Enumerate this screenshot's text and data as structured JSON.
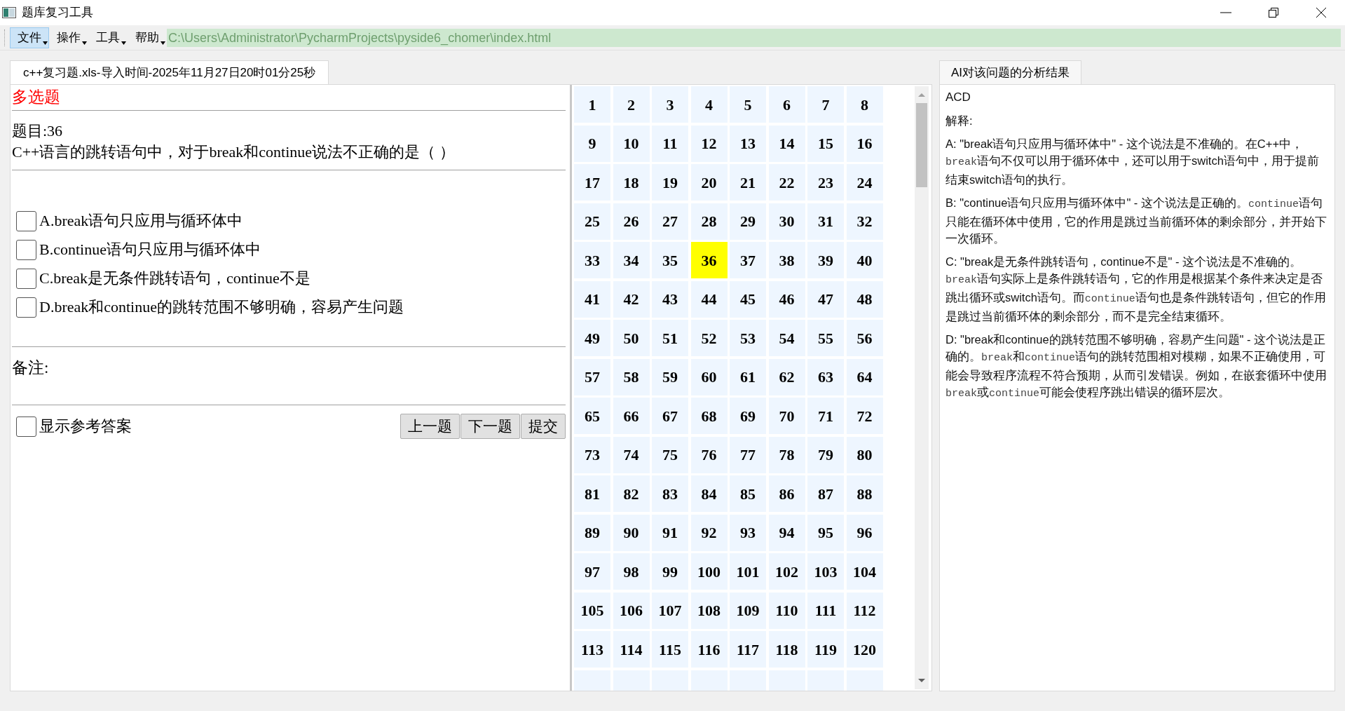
{
  "window": {
    "title": "题库复习工具"
  },
  "menu": [
    {
      "label": "文件",
      "selected": true
    },
    {
      "label": "操作",
      "selected": false
    },
    {
      "label": "工具",
      "selected": false
    },
    {
      "label": "帮助",
      "selected": false
    }
  ],
  "path_field": {
    "value": "C:\\Users\\Administrator\\PycharmProjects\\pyside6_chomer\\index.html"
  },
  "left_tab": {
    "label": "c++复习题.xls-导入时间-2025年11月27日20时01分25秒",
    "selected": true
  },
  "question": {
    "type_label": "多选题",
    "number": "题目:36",
    "text": "C++语言的跳转语句中，对于break和continue说法不正确的是（ ）",
    "options": [
      {
        "label": "A.break语句只应用与循环体中",
        "checked": false
      },
      {
        "label": "B.continue语句只应用与循环体中",
        "checked": false
      },
      {
        "label": "C.break是无条件跳转语句，continue不是",
        "checked": false
      },
      {
        "label": "D.break和continue的跳转范围不够明确，容易产生问题",
        "checked": false
      }
    ],
    "notes_label": "备注:",
    "show_answer": {
      "label": "显示参考答案",
      "checked": false
    }
  },
  "buttons": [
    "上一题",
    "下一题",
    "提交"
  ],
  "grid": {
    "cells": [
      {
        "label": "1",
        "selected": false
      },
      {
        "label": "2",
        "selected": false
      },
      {
        "label": "3",
        "selected": false
      },
      {
        "label": "4",
        "selected": false
      },
      {
        "label": "5",
        "selected": false
      },
      {
        "label": "6",
        "selected": false
      },
      {
        "label": "7",
        "selected": false
      },
      {
        "label": "8",
        "selected": false
      },
      {
        "label": "9",
        "selected": false
      },
      {
        "label": "10",
        "selected": false
      },
      {
        "label": "11",
        "selected": false
      },
      {
        "label": "12",
        "selected": false
      },
      {
        "label": "13",
        "selected": false
      },
      {
        "label": "14",
        "selected": false
      },
      {
        "label": "15",
        "selected": false
      },
      {
        "label": "16",
        "selected": false
      },
      {
        "label": "17",
        "selected": false
      },
      {
        "label": "18",
        "selected": false
      },
      {
        "label": "19",
        "selected": false
      },
      {
        "label": "20",
        "selected": false
      },
      {
        "label": "21",
        "selected": false
      },
      {
        "label": "22",
        "selected": false
      },
      {
        "label": "23",
        "selected": false
      },
      {
        "label": "24",
        "selected": false
      },
      {
        "label": "25",
        "selected": false
      },
      {
        "label": "26",
        "selected": false
      },
      {
        "label": "27",
        "selected": false
      },
      {
        "label": "28",
        "selected": false
      },
      {
        "label": "29",
        "selected": false
      },
      {
        "label": "30",
        "selected": false
      },
      {
        "label": "31",
        "selected": false
      },
      {
        "label": "32",
        "selected": false
      },
      {
        "label": "33",
        "selected": false
      },
      {
        "label": "34",
        "selected": false
      },
      {
        "label": "35",
        "selected": false
      },
      {
        "label": "36",
        "selected": true
      },
      {
        "label": "37",
        "selected": false
      },
      {
        "label": "38",
        "selected": false
      },
      {
        "label": "39",
        "selected": false
      },
      {
        "label": "40",
        "selected": false
      },
      {
        "label": "41",
        "selected": false
      },
      {
        "label": "42",
        "selected": false
      },
      {
        "label": "43",
        "selected": false
      },
      {
        "label": "44",
        "selected": false
      },
      {
        "label": "45",
        "selected": false
      },
      {
        "label": "46",
        "selected": false
      },
      {
        "label": "47",
        "selected": false
      },
      {
        "label": "48",
        "selected": false
      },
      {
        "label": "49",
        "selected": false
      },
      {
        "label": "50",
        "selected": false
      },
      {
        "label": "51",
        "selected": false
      },
      {
        "label": "52",
        "selected": false
      },
      {
        "label": "53",
        "selected": false
      },
      {
        "label": "54",
        "selected": false
      },
      {
        "label": "55",
        "selected": false
      },
      {
        "label": "56",
        "selected": false
      },
      {
        "label": "57",
        "selected": false
      },
      {
        "label": "58",
        "selected": false
      },
      {
        "label": "59",
        "selected": false
      },
      {
        "label": "60",
        "selected": false
      },
      {
        "label": "61",
        "selected": false
      },
      {
        "label": "62",
        "selected": false
      },
      {
        "label": "63",
        "selected": false
      },
      {
        "label": "64",
        "selected": false
      },
      {
        "label": "65",
        "selected": false
      },
      {
        "label": "66",
        "selected": false
      },
      {
        "label": "67",
        "selected": false
      },
      {
        "label": "68",
        "selected": false
      },
      {
        "label": "69",
        "selected": false
      },
      {
        "label": "70",
        "selected": false
      },
      {
        "label": "71",
        "selected": false
      },
      {
        "label": "72",
        "selected": false
      },
      {
        "label": "73",
        "selected": false
      },
      {
        "label": "74",
        "selected": false
      },
      {
        "label": "75",
        "selected": false
      },
      {
        "label": "76",
        "selected": false
      },
      {
        "label": "77",
        "selected": false
      },
      {
        "label": "78",
        "selected": false
      },
      {
        "label": "79",
        "selected": false
      },
      {
        "label": "80",
        "selected": false
      },
      {
        "label": "81",
        "selected": false
      },
      {
        "label": "82",
        "selected": false
      },
      {
        "label": "83",
        "selected": false
      },
      {
        "label": "84",
        "selected": false
      },
      {
        "label": "85",
        "selected": false
      },
      {
        "label": "86",
        "selected": false
      },
      {
        "label": "87",
        "selected": false
      },
      {
        "label": "88",
        "selected": false
      },
      {
        "label": "89",
        "selected": false
      },
      {
        "label": "90",
        "selected": false
      },
      {
        "label": "91",
        "selected": false
      },
      {
        "label": "92",
        "selected": false
      },
      {
        "label": "93",
        "selected": false
      },
      {
        "label": "94",
        "selected": false
      },
      {
        "label": "95",
        "selected": false
      },
      {
        "label": "96",
        "selected": false
      },
      {
        "label": "97",
        "selected": false
      },
      {
        "label": "98",
        "selected": false
      },
      {
        "label": "99",
        "selected": false
      },
      {
        "label": "100",
        "selected": false
      },
      {
        "label": "101",
        "selected": false
      },
      {
        "label": "102",
        "selected": false
      },
      {
        "label": "103",
        "selected": false
      },
      {
        "label": "104",
        "selected": false
      },
      {
        "label": "105",
        "selected": false
      },
      {
        "label": "106",
        "selected": false
      },
      {
        "label": "107",
        "selected": false
      },
      {
        "label": "108",
        "selected": false
      },
      {
        "label": "109",
        "selected": false
      },
      {
        "label": "110",
        "selected": false
      },
      {
        "label": "111",
        "selected": false
      },
      {
        "label": "112",
        "selected": false
      },
      {
        "label": "113",
        "selected": false
      },
      {
        "label": "114",
        "selected": false
      },
      {
        "label": "115",
        "selected": false
      },
      {
        "label": "116",
        "selected": false
      },
      {
        "label": "117",
        "selected": false
      },
      {
        "label": "118",
        "selected": false
      },
      {
        "label": "119",
        "selected": false
      },
      {
        "label": "120",
        "selected": false
      }
    ]
  },
  "analysis": {
    "tab": "AI对该问题的分析结果",
    "answer": "ACD",
    "heading": "解释:",
    "paragraphs": [
      [
        {
          "kind": "text",
          "text": "A: \"break语句只应用与循环体中\" - 这个说法是不准确的。在C++中，"
        },
        {
          "kind": "code",
          "text": "break"
        },
        {
          "kind": "text",
          "text": "语句不仅可以用于循环体中，还可以用于switch语句中，用于提前结束switch语句的执行。"
        }
      ],
      [
        {
          "kind": "text",
          "text": "B: \"continue语句只应用与循环体中\" - 这个说法是正确的。"
        },
        {
          "kind": "code",
          "text": "continue"
        },
        {
          "kind": "text",
          "text": "语句只能在循环体中使用，它的作用是跳过当前循环体的剩余部分，并开始下一次循环。"
        }
      ],
      [
        {
          "kind": "text",
          "text": "C: \"break是无条件跳转语句，continue不是\" - 这个说法是不准确的。"
        },
        {
          "kind": "code",
          "text": "break"
        },
        {
          "kind": "text",
          "text": "语句实际上是条件跳转语句，它的作用是根据某个条件来决定是否跳出循环或switch语句。而"
        },
        {
          "kind": "code",
          "text": "continue"
        },
        {
          "kind": "text",
          "text": "语句也是条件跳转语句，但它的作用是跳过当前循环体的剩余部分，而不是完全结束循环。"
        }
      ],
      [
        {
          "kind": "text",
          "text": "D: \"break和continue的跳转范围不够明确，容易产生问题\" - 这个说法是正确的。"
        },
        {
          "kind": "code",
          "text": "break"
        },
        {
          "kind": "text",
          "text": "和"
        },
        {
          "kind": "code",
          "text": "continue"
        },
        {
          "kind": "text",
          "text": "语句的跳转范围相对模糊，如果不正确使用，可能会导致程序流程不符合预期，从而引发错误。例如，在嵌套循环中使用"
        },
        {
          "kind": "code",
          "text": "break"
        },
        {
          "kind": "text",
          "text": "或"
        },
        {
          "kind": "code",
          "text": "continue"
        },
        {
          "kind": "text",
          "text": "可能会使程序跳出错误的循环层次。"
        }
      ]
    ]
  }
}
